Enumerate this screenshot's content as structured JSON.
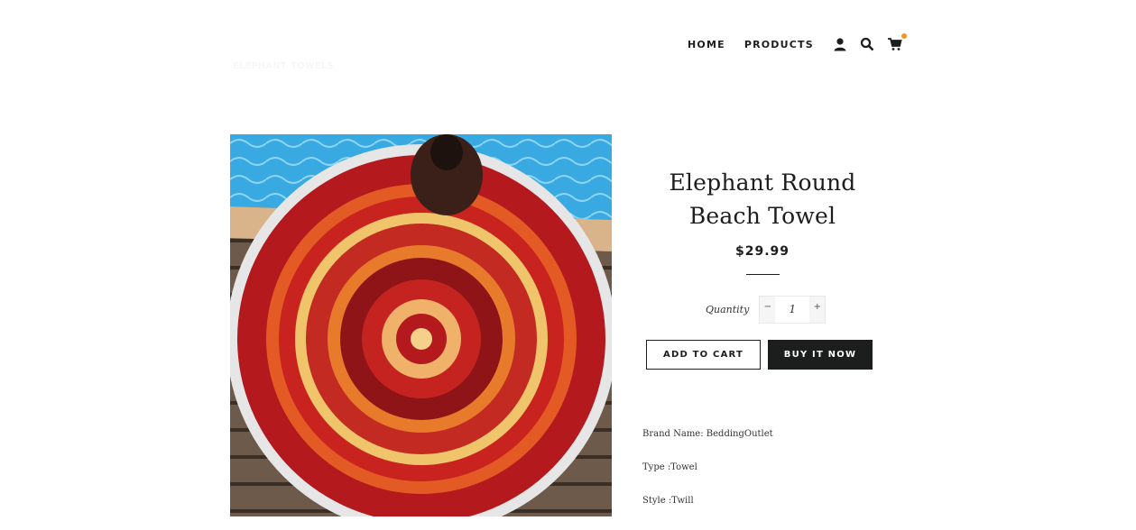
{
  "header": {
    "logo_text": "ELEPHANT TOWELS",
    "nav": [
      {
        "label": "HOME"
      },
      {
        "label": "PRODUCTS"
      }
    ],
    "icons": [
      "account-icon",
      "search-icon",
      "cart-icon"
    ],
    "cart_dot_color": "#f3922a"
  },
  "product": {
    "title": "Elephant Round Beach Towel",
    "price": "$29.99",
    "quantity_label": "Quantity",
    "quantity_value": "1",
    "decrement": "−",
    "increment": "+",
    "add_to_cart": "ADD TO CART",
    "buy_now": "BUY IT NOW",
    "description": [
      "Brand Name: BeddingOutlet",
      "Type :Towel",
      "Style :Twill"
    ]
  },
  "colors": {
    "text": "#1c1d1d",
    "towel_red": "#b3191d",
    "pool": "#3aa7e0"
  }
}
